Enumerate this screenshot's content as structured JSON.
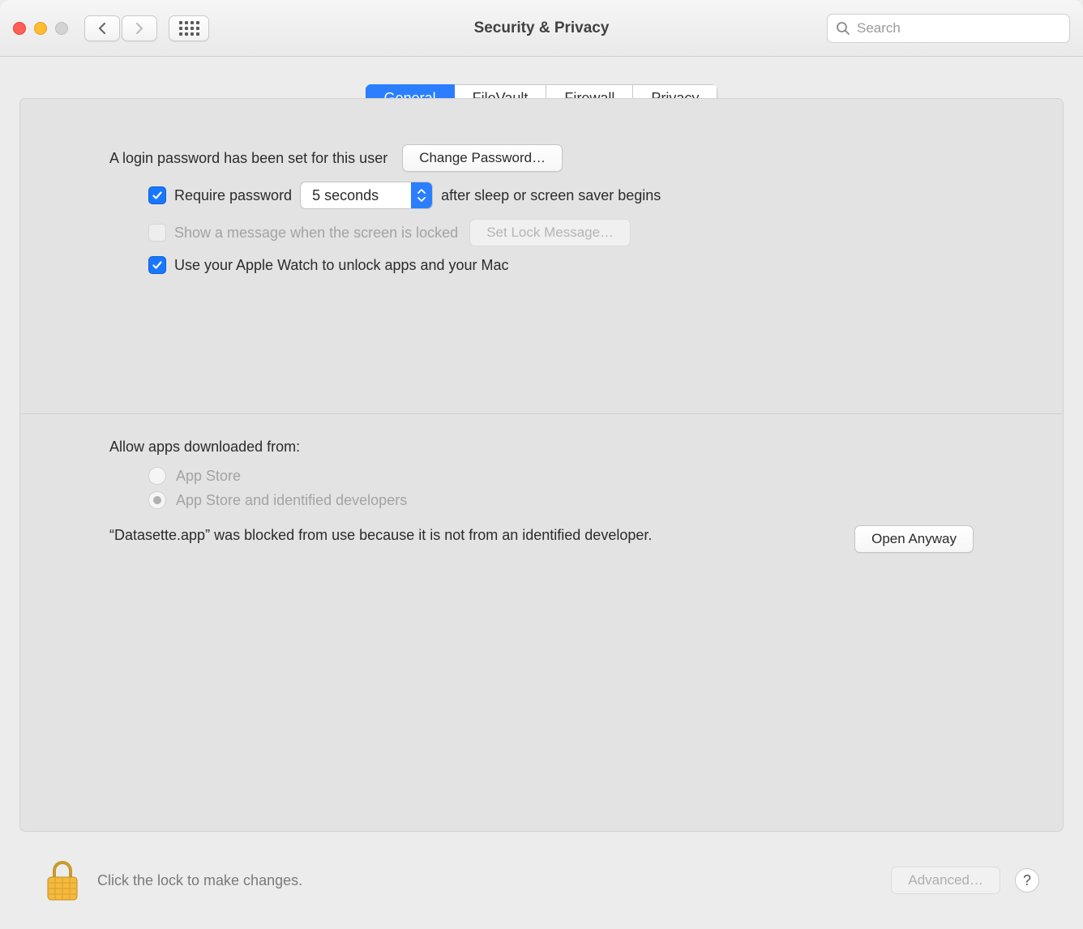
{
  "toolbar": {
    "title": "Security & Privacy",
    "search_placeholder": "Search"
  },
  "tabs": {
    "general": "General",
    "filevault": "FileVault",
    "firewall": "Firewall",
    "privacy": "Privacy"
  },
  "general": {
    "login_pw_set": "A login password has been set for this user",
    "change_pw": "Change Password…",
    "require_pw": "Require password",
    "delay_value": "5 seconds",
    "require_pw_suffix": "after sleep or screen saver begins",
    "show_msg": "Show a message when the screen is locked",
    "set_lock_msg": "Set Lock Message…",
    "apple_watch": "Use your Apple Watch to unlock apps and your Mac",
    "allow_heading": "Allow apps downloaded from:",
    "opt_appstore": "App Store",
    "opt_identified": "App Store and identified developers",
    "blocked_msg": "“Datasette.app” was blocked from use because it is not from an identified developer.",
    "open_anyway": "Open Anyway"
  },
  "footer": {
    "lock_hint": "Click the lock to make changes.",
    "advanced": "Advanced…",
    "help": "?"
  }
}
